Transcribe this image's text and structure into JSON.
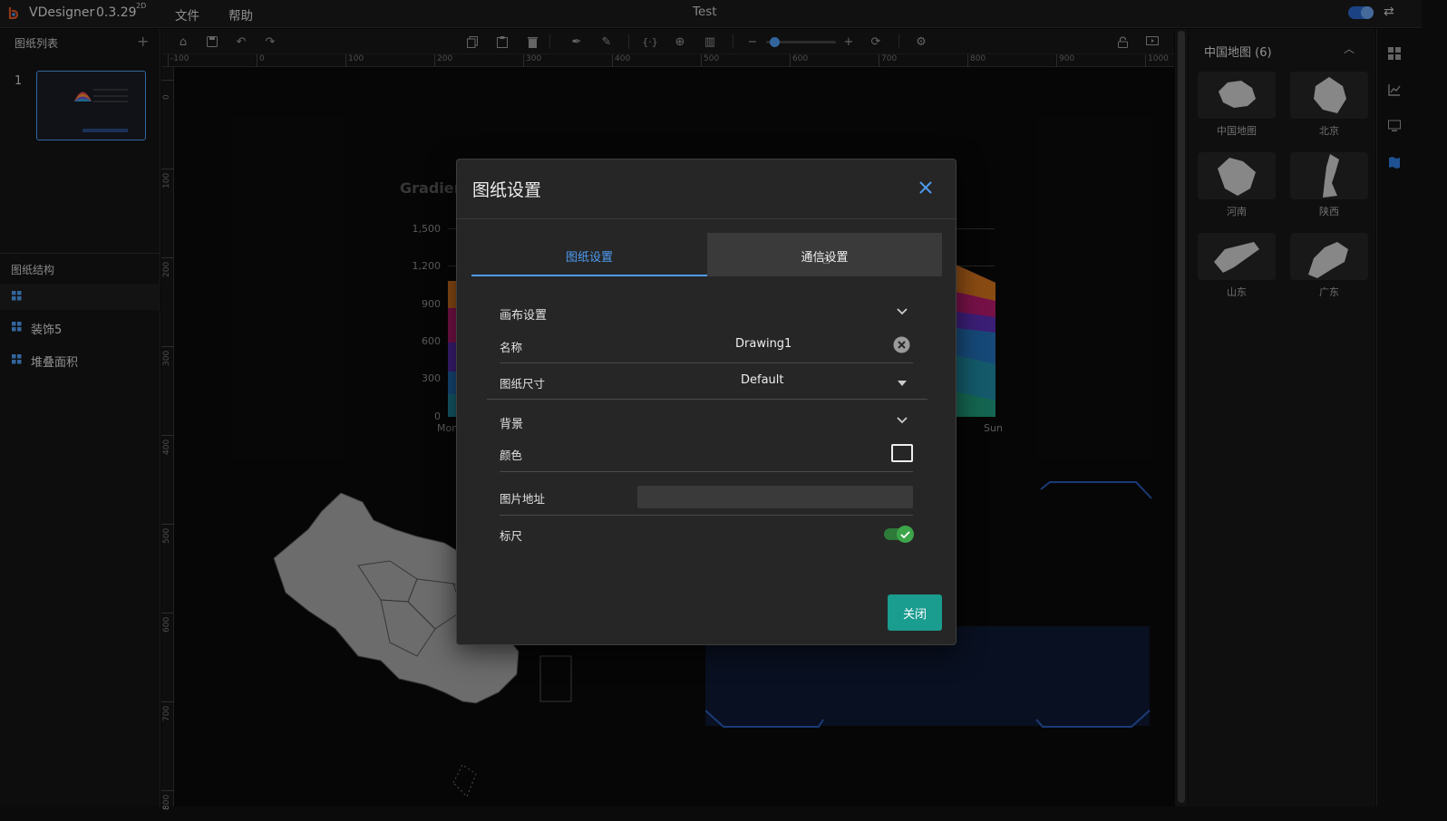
{
  "app": {
    "name": "VDesigner",
    "version": "0.3.29",
    "mode": "2D",
    "menu": [
      "文件",
      "帮助"
    ],
    "title": "Test"
  },
  "left": {
    "pages_title": "图纸列表",
    "add_symbol": "+",
    "page_number": "1",
    "structure_title": "图纸结构",
    "tree": [
      {
        "label": ""
      },
      {
        "label": "装饰5"
      },
      {
        "label": "堆叠面积"
      }
    ]
  },
  "ruler": {
    "x_labels": [
      "-100",
      "0",
      "100",
      "200",
      "300",
      "400",
      "500",
      "600",
      "700",
      "800",
      "900",
      "1000"
    ],
    "y_labels": [
      "0",
      "100",
      "200",
      "300",
      "400",
      "500",
      "600",
      "700",
      "800"
    ]
  },
  "canvas": {
    "chart_title": "Gradien",
    "y_ticks": [
      "1,500",
      "1,200",
      "900",
      "600",
      "300",
      "0"
    ],
    "x_first": "Mon",
    "x_last": "Sun"
  },
  "right": {
    "panel_title": "中国地图 (6)",
    "maps": [
      "中国地图",
      "北京",
      "河南",
      "陕西",
      "山东",
      "广东"
    ]
  },
  "dialog": {
    "title": "图纸设置",
    "tabs": [
      "图纸设置",
      "通信设置"
    ],
    "section_canvas": "画布设置",
    "name_label": "名称",
    "name_value": "Drawing1",
    "size_label": "图纸尺寸",
    "size_value": "Default",
    "section_bg": "背景",
    "color_label": "颜色",
    "image_label": "图片地址",
    "image_value": "",
    "ruler_label": "标尺",
    "ruler_on": true,
    "close_button": "关闭"
  },
  "colors": {
    "accent": "#4f9cf2",
    "teal": "#1a9c8f",
    "toggle": "#3da54a"
  }
}
